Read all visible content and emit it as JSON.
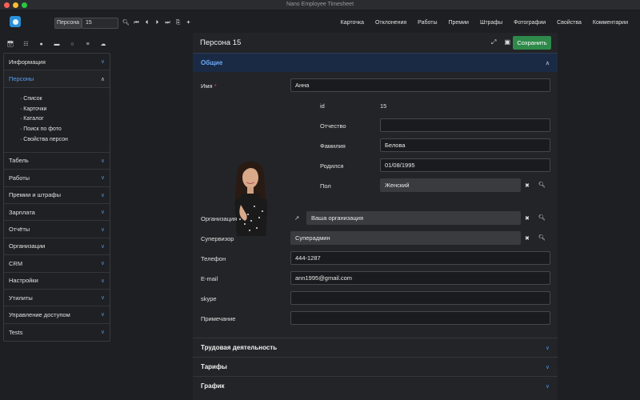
{
  "window": {
    "title": "Nano Employee Timesheet"
  },
  "toolbar": {
    "record_label": "Персона",
    "record_value": "15",
    "icons": [
      "search-icon",
      "first-icon",
      "prev-icon",
      "next-icon",
      "last-icon",
      "copy-icon",
      "add-icon"
    ]
  },
  "topnav": [
    "Карточка",
    "Отклонения",
    "Работы",
    "Премии",
    "Штрафы",
    "Фотографии",
    "Свойства",
    "Комментарии"
  ],
  "sidebar": {
    "items": [
      {
        "label": "Информация"
      },
      {
        "label": "Персоны",
        "active": true,
        "sub": [
          "· Список",
          "· Карточки",
          "· Каталог",
          "· Поиск по фото",
          "· Свойства персон"
        ]
      },
      {
        "label": "Табель"
      },
      {
        "label": "Работы"
      },
      {
        "label": "Премии и штрафы"
      },
      {
        "label": "Зарплата"
      },
      {
        "label": "Отчёты"
      },
      {
        "label": "Организации"
      },
      {
        "label": "CRM"
      },
      {
        "label": "Настройки"
      },
      {
        "label": "Утилиты"
      },
      {
        "label": "Управление доступом"
      },
      {
        "label": "Tests"
      }
    ]
  },
  "main": {
    "title": "Персона 15",
    "save_label": "Сохранить",
    "section_general": "Общие",
    "name": {
      "label": "Имя",
      "required_mark": "*",
      "value": "Анна"
    },
    "id": {
      "label": "id",
      "value": "15"
    },
    "patronymic": {
      "label": "Отчество",
      "value": ""
    },
    "surname": {
      "label": "Фамилия",
      "value": "Белова"
    },
    "birth": {
      "label": "Родился",
      "value": "01/08/1995"
    },
    "gender": {
      "label": "Пол",
      "value": "Женский"
    },
    "org": {
      "label": "Организация",
      "value": "Ваша организация"
    },
    "supervisor": {
      "label": "Супервизор",
      "value": "Суперадмин"
    },
    "phone": {
      "label": "Телефон",
      "value": "444-1287"
    },
    "email": {
      "label": "E-mail",
      "value": "ann1995@gmail.com"
    },
    "skype": {
      "label": "skype",
      "value": ""
    },
    "note": {
      "label": "Примечание",
      "value": ""
    },
    "collapsed": [
      "Трудовая деятельность",
      "Тарифы",
      "График"
    ]
  },
  "colors": {
    "accent_blue": "#5aa0f0",
    "save_green": "#2e8a4a",
    "section_bg": "#1b2a44"
  }
}
